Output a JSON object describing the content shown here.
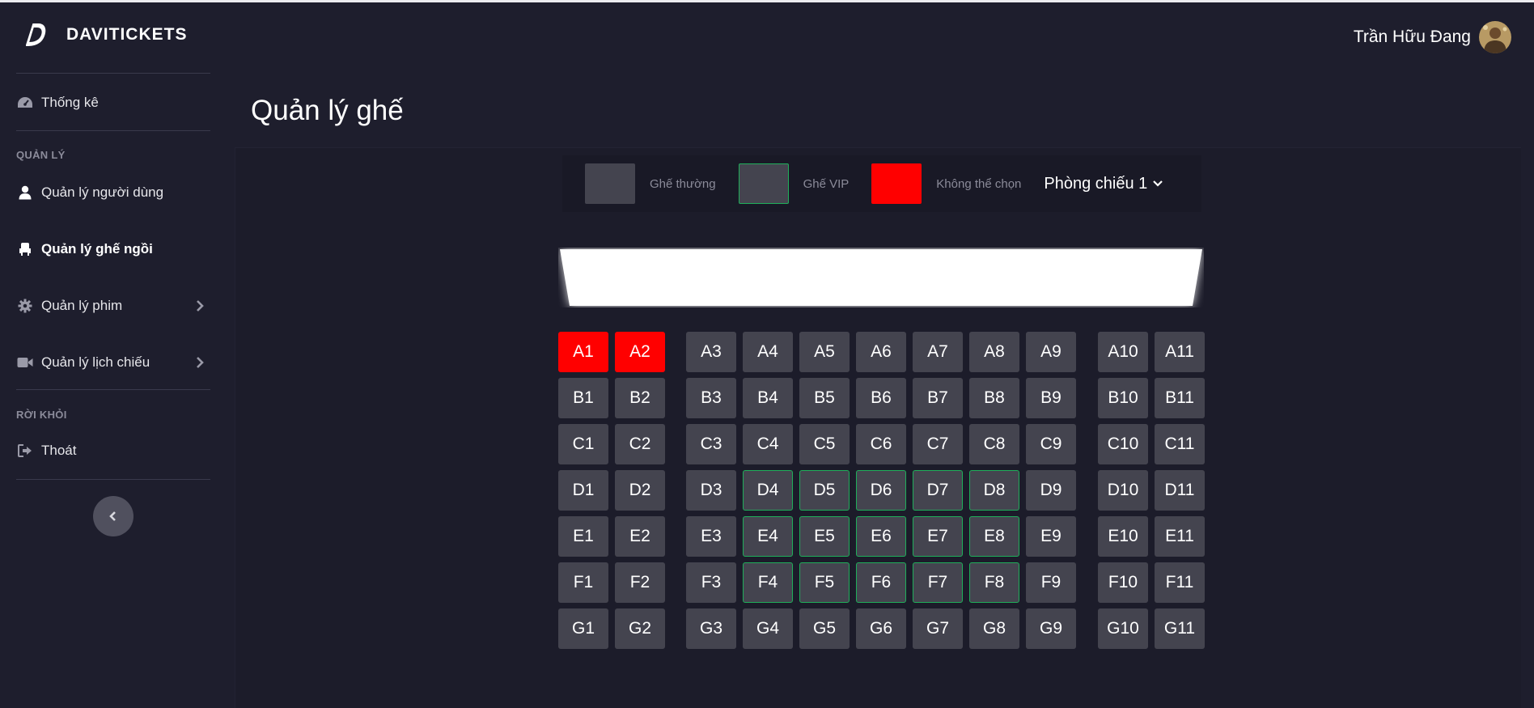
{
  "brand": {
    "name": "DAVITICKETS"
  },
  "user": {
    "name": "Trần Hữu Đang"
  },
  "sidebar": {
    "dashboard": "Thống kê",
    "section_manage": "QUẢN LÝ",
    "items": [
      {
        "label": "Quản lý người dùng"
      },
      {
        "label": "Quản lý ghế ngồi"
      },
      {
        "label": "Quản lý phim"
      },
      {
        "label": "Quản lý lịch chiếu"
      }
    ],
    "section_leave": "RỜI KHỎI",
    "logout": "Thoát",
    "active_item": "Quản lý ghế ngồi"
  },
  "page": {
    "title": "Quản lý ghế"
  },
  "legend": {
    "normal": "Ghế thường",
    "vip": "Ghế VIP",
    "blocked": "Không thể chọn",
    "room": "Phòng chiếu 1"
  },
  "colors": {
    "seat_normal": "#44444f",
    "seat_vip_border": "#1fae5a",
    "seat_blocked": "#ff0000",
    "background": "#1e1e2d"
  },
  "seat_map": {
    "rows": [
      "A",
      "B",
      "C",
      "D",
      "E",
      "F",
      "G"
    ],
    "columns": [
      1,
      2,
      3,
      4,
      5,
      6,
      7,
      8,
      9,
      10,
      11
    ],
    "blocked": [
      "A1",
      "A2"
    ],
    "vip": [
      "D4",
      "D5",
      "D6",
      "D7",
      "D8",
      "E4",
      "E5",
      "E6",
      "E7",
      "E8",
      "F4",
      "F5",
      "F6",
      "F7",
      "F8"
    ]
  }
}
